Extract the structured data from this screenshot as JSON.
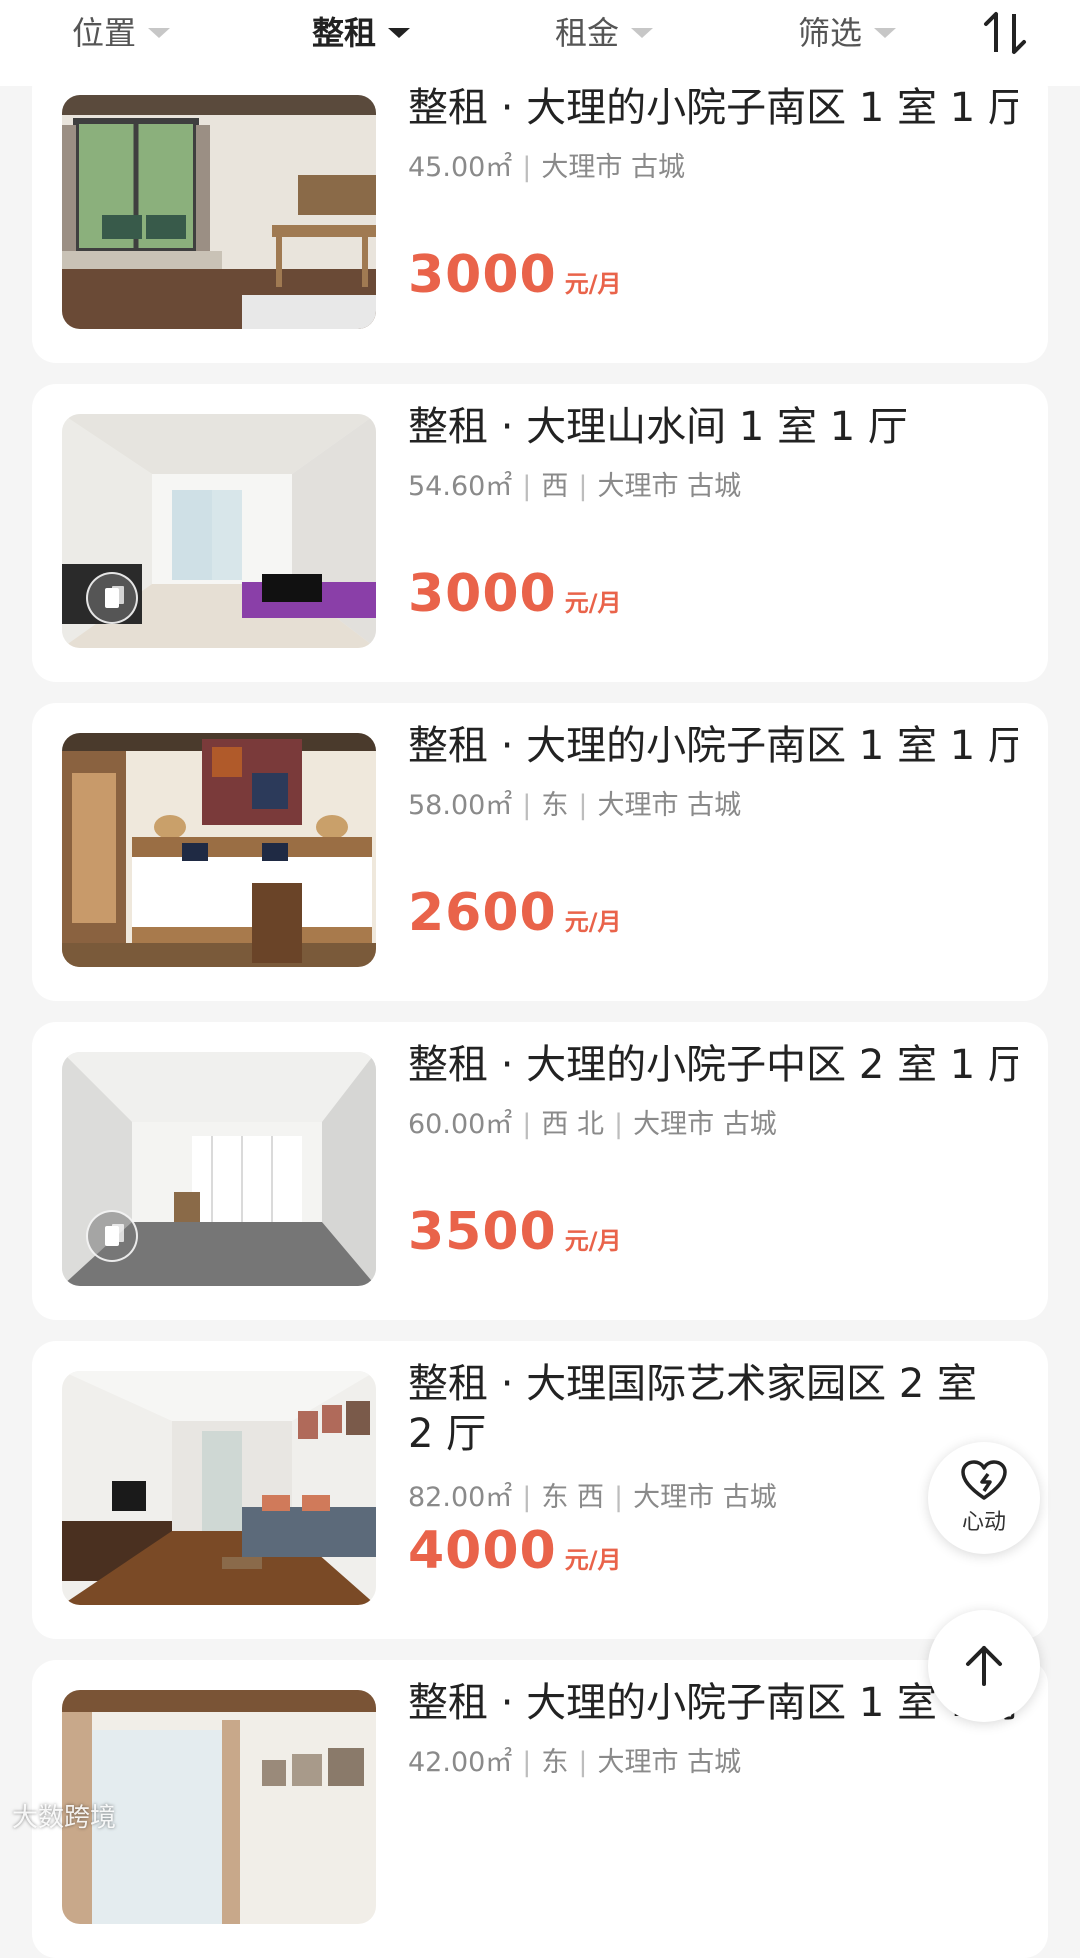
{
  "filters": {
    "items": [
      {
        "label": "位置"
      },
      {
        "label": "整租"
      },
      {
        "label": "租金"
      },
      {
        "label": "筛选"
      }
    ],
    "sort_icon": "sort-icon"
  },
  "listings": [
    {
      "title": "整租 · 大理的小院子南区 1 室 1 厅",
      "area": "45.00㎡",
      "orientation": "",
      "location": "大理市 古城",
      "price": "3000",
      "unit": "元/月",
      "has_vr": false
    },
    {
      "title": "整租 · 大理山水间 1 室 1 厅",
      "area": "54.60㎡",
      "orientation": "西",
      "location": "大理市 古城",
      "price": "3000",
      "unit": "元/月",
      "has_vr": true
    },
    {
      "title": "整租 · 大理的小院子南区 1 室 1 厅",
      "area": "58.00㎡",
      "orientation": "东",
      "location": "大理市 古城",
      "price": "2600",
      "unit": "元/月",
      "has_vr": false
    },
    {
      "title": "整租 · 大理的小院子中区 2 室 1 厅",
      "area": "60.00㎡",
      "orientation": "西 北",
      "location": "大理市 古城",
      "price": "3500",
      "unit": "元/月",
      "has_vr": true
    },
    {
      "title": "整租 · 大理国际艺术家园区 2 室 2 厅",
      "area": "82.00㎡",
      "orientation": "东 西",
      "location": "大理市 古城",
      "price": "4000",
      "unit": "元/月",
      "has_vr": false
    },
    {
      "title": "整租 · 大理的小院子南区 1 室 1 厅",
      "area": "42.00㎡",
      "orientation": "东",
      "location": "大理市 古城",
      "price": "",
      "unit": "",
      "has_vr": false
    }
  ],
  "floating": {
    "favorite_label": "心动",
    "favorite_icon": "heart-icon",
    "top_icon": "arrow-up-icon"
  },
  "watermark": "大数跨境",
  "colors": {
    "price": "#e9634a",
    "background": "#f5f5f5"
  }
}
